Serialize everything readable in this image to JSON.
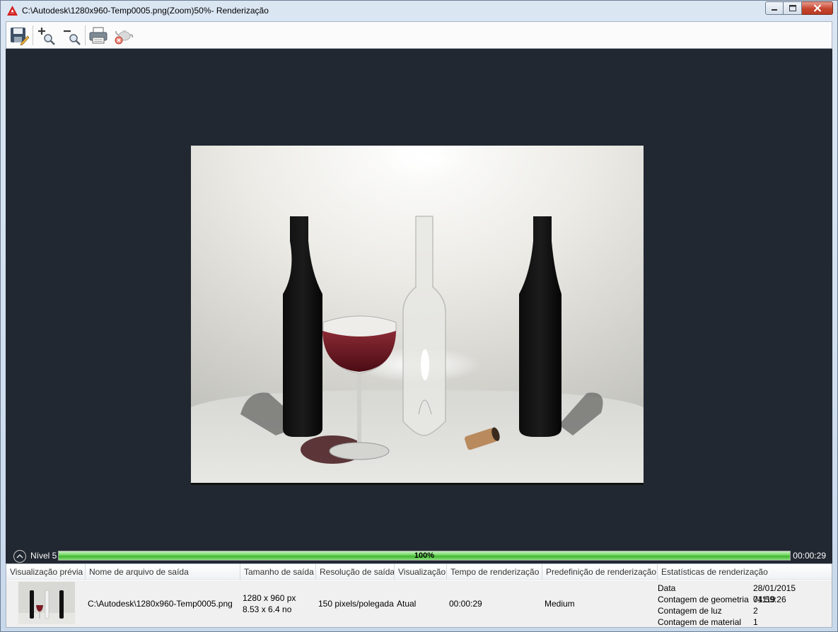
{
  "window": {
    "title": "C:\\Autodesk\\1280x960-Temp0005.png(Zoom)50%- Renderização"
  },
  "toolbar": {
    "save_icon": "save-icon",
    "zoom_in_icon": "zoom-in-icon",
    "zoom_out_icon": "zoom-out-icon",
    "print_icon": "print-icon",
    "cancel_render_icon": "teapot-cancel-icon"
  },
  "progress": {
    "level": "Nível 5",
    "percent_text": "100%",
    "fraction": 1.0,
    "elapsed": "00:00:29"
  },
  "history": {
    "headers": [
      "Visualização prévia",
      "Nome de arquivo de saída",
      "Tamanho de saída",
      "Resolução de saída",
      "Visualização",
      "Tempo de renderização",
      "Predefinição de renderização",
      "Estatísticas de renderização"
    ],
    "row": {
      "filename": "C:\\Autodesk\\1280x960-Temp0005.png",
      "size_px": "1280 x 960 px",
      "size_in": "8.53 x 6.4 no",
      "resolution": "150 pixels/polegada",
      "view": "Atual",
      "render_time": "00:00:29",
      "preset": "Medium",
      "stats": [
        {
          "label": "Data",
          "value": "28/01/2015 04:59:26"
        },
        {
          "label": "Contagem de geometria",
          "value": "71119"
        },
        {
          "label": "Contagem de luz",
          "value": "2"
        },
        {
          "label": "Contagem de material",
          "value": "1"
        }
      ]
    }
  },
  "colors": {
    "viewport_bg": "#222831",
    "progress_green": "#3fb52f",
    "close_red": "#c5452d"
  }
}
